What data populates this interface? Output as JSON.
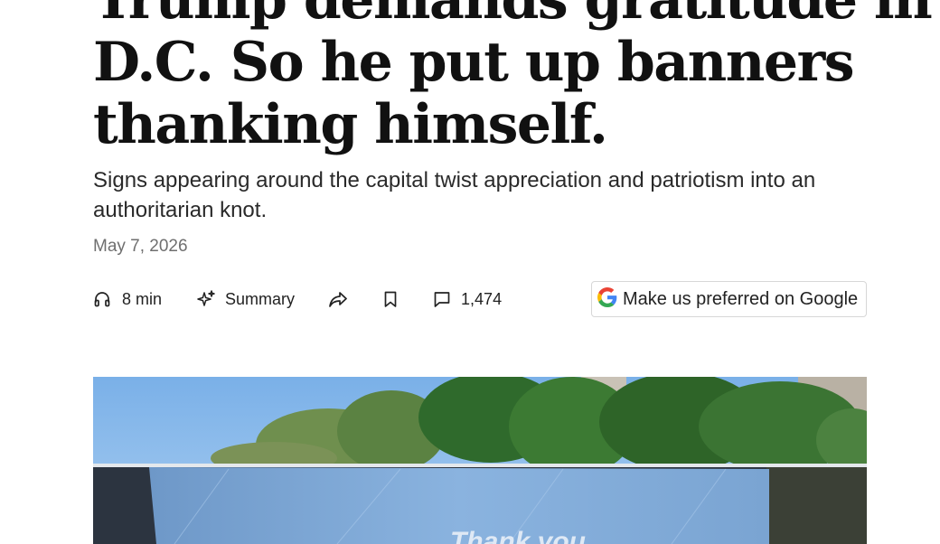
{
  "article": {
    "headline_lines": [
      "Trump demands gratitude in",
      "D.C. So he put up banners",
      "thanking himself."
    ],
    "dek": "Signs appearing around the capital twist appreciation and patriotism into an authoritarian knot.",
    "date": "May 7, 2026"
  },
  "actions": {
    "listen_label": "8 min",
    "summary_label": "Summary",
    "comments_count": "1,474",
    "google_label": "Make us preferred on Google"
  },
  "photo": {
    "banner_text": "Thank you"
  },
  "colors": {
    "text": "#111111",
    "muted": "#6f6f6f",
    "border": "#d7d7d7",
    "sky": "#86b4e6",
    "banner": "#7fa8d6"
  },
  "icons": [
    "headphones-icon",
    "sparkle-icon",
    "share-arrow-icon",
    "bookmark-icon",
    "comment-icon",
    "google-g-icon"
  ]
}
